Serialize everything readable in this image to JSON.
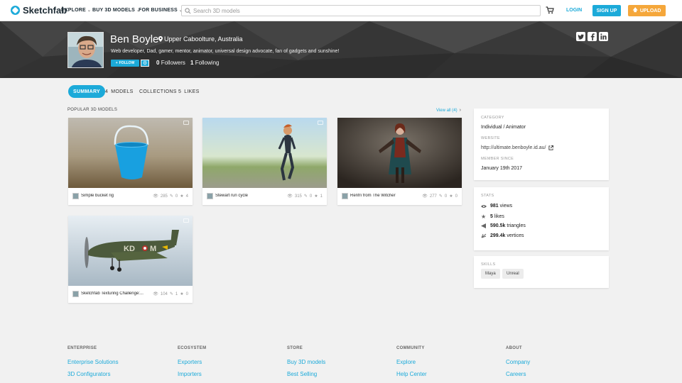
{
  "brand": {
    "name": "Sketchfab",
    "color": "#1caad9",
    "upload_color": "#f5a73b"
  },
  "nav": {
    "explore": "EXPLORE",
    "buy": "BUY 3D MODELS",
    "business": "FOR BUSINESS",
    "search_placeholder": "Search 3D models",
    "login": "LOGIN",
    "signup": "SIGN UP",
    "upload": "UPLOAD"
  },
  "profile": {
    "name": "Ben Boyle",
    "location": "Upper Caboolture, Australia",
    "bio": "Web developer, Dad, gamer, mentor, animator, universal design advocate, fan of gadgets and sunshine!",
    "follow": "FOLLOW",
    "followers_count": "0",
    "followers_label": "Followers",
    "following_count": "1",
    "following_label": "Following",
    "social": [
      "twitter-icon",
      "facebook-icon",
      "linkedin-icon"
    ]
  },
  "tabs": [
    {
      "count": "",
      "label": "SUMMARY",
      "active": true
    },
    {
      "count": "4",
      "label": "MODELS"
    },
    {
      "count": "",
      "label": "COLLECTIONS"
    },
    {
      "count": "5",
      "label": "LIKES"
    }
  ],
  "popular": {
    "title": "POPULAR 3D MODELS",
    "view_all": "View all (4)",
    "models": [
      {
        "name": "Simple bucket rig",
        "views": "285",
        "comments": "0",
        "likes": "4"
      },
      {
        "name": "Stewart run cycle",
        "views": "315",
        "comments": "0",
        "likes": "1"
      },
      {
        "name": "Renfri from The Witcher",
        "views": "277",
        "comments": "0",
        "likes": "0"
      },
      {
        "name": "Sketchfab Texturing Challenge:...",
        "views": "104",
        "comments": "1",
        "likes": "0"
      }
    ]
  },
  "about": {
    "category_label": "CATEGORY",
    "category": "Individual / Animator",
    "website_label": "WEBSITE",
    "website": "http://ultimate.benboyle.id.au/",
    "member_label": "MEMBER SINCE",
    "member_since": "January 19th 2017"
  },
  "stats": {
    "label": "STATS",
    "views_value": "981",
    "views_label": "views",
    "likes_value": "5",
    "likes_label": "likes",
    "triangles_value": "590.5k",
    "triangles_label": "triangles",
    "vertices_value": "299.4k",
    "vertices_label": "vertices"
  },
  "skills": {
    "label": "SKILLS",
    "items": [
      "Maya",
      "Unreal"
    ]
  },
  "footer": {
    "columns": [
      {
        "heading": "ENTERPRISE",
        "links": [
          "Enterprise Solutions",
          "3D Configurators"
        ]
      },
      {
        "heading": "ECOSYSTEM",
        "links": [
          "Exporters",
          "Importers"
        ]
      },
      {
        "heading": "STORE",
        "links": [
          "Buy 3D models",
          "Best Selling"
        ]
      },
      {
        "heading": "COMMUNITY",
        "links": [
          "Explore",
          "Help Center"
        ]
      },
      {
        "heading": "ABOUT",
        "links": [
          "Company",
          "Careers"
        ]
      }
    ]
  }
}
